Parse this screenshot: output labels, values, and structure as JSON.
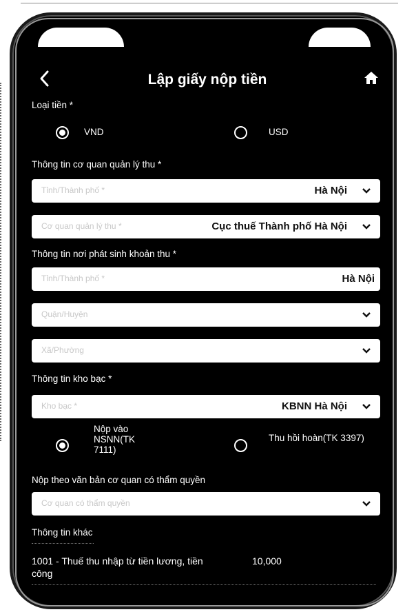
{
  "header": {
    "title": "Lập giấy nộp tiền",
    "back_icon": "chevron-left-icon",
    "home_icon": "home-icon"
  },
  "currency": {
    "label": "Loại tiền *",
    "options": [
      {
        "label": "VND",
        "selected": true
      },
      {
        "label": "USD",
        "selected": false
      }
    ]
  },
  "tax_authority": {
    "label": "Thông tin cơ quan quản lý thu *",
    "province": {
      "placeholder": "Tỉnh/Thành phố *",
      "value": "Hà Nội"
    },
    "authority": {
      "placeholder": "Cơ quan quản lý thu *",
      "value": "Cục thuế Thành phố Hà Nội"
    }
  },
  "origin": {
    "label": "Thông tin nơi phát sinh khoản thu *",
    "province": {
      "placeholder": "Tỉnh/Thành phố *",
      "value": "Hà Nội"
    },
    "district": {
      "placeholder": "Quận/Huyện"
    },
    "ward": {
      "placeholder": "Xã/Phường"
    }
  },
  "treasury": {
    "label": "Thông tin kho bạc *",
    "field": {
      "placeholder": "Kho bạc *",
      "value": "KBNN Hà Nội"
    },
    "options": [
      {
        "label": "Nộp vào NSNN(TK 7111)",
        "selected": true
      },
      {
        "label": "Thu hồi hoàn(TK 3397)",
        "selected": false
      }
    ]
  },
  "authority_doc": {
    "label": "Nộp theo văn bản cơ quan có thẩm quyền",
    "field": {
      "placeholder": "Cơ quan có thẩm quyền"
    }
  },
  "other": {
    "label": "Thông tin khác",
    "item": {
      "text": "1001 - Thuế thu nhập từ tiền lương, tiền công",
      "amount": "10,000"
    }
  }
}
